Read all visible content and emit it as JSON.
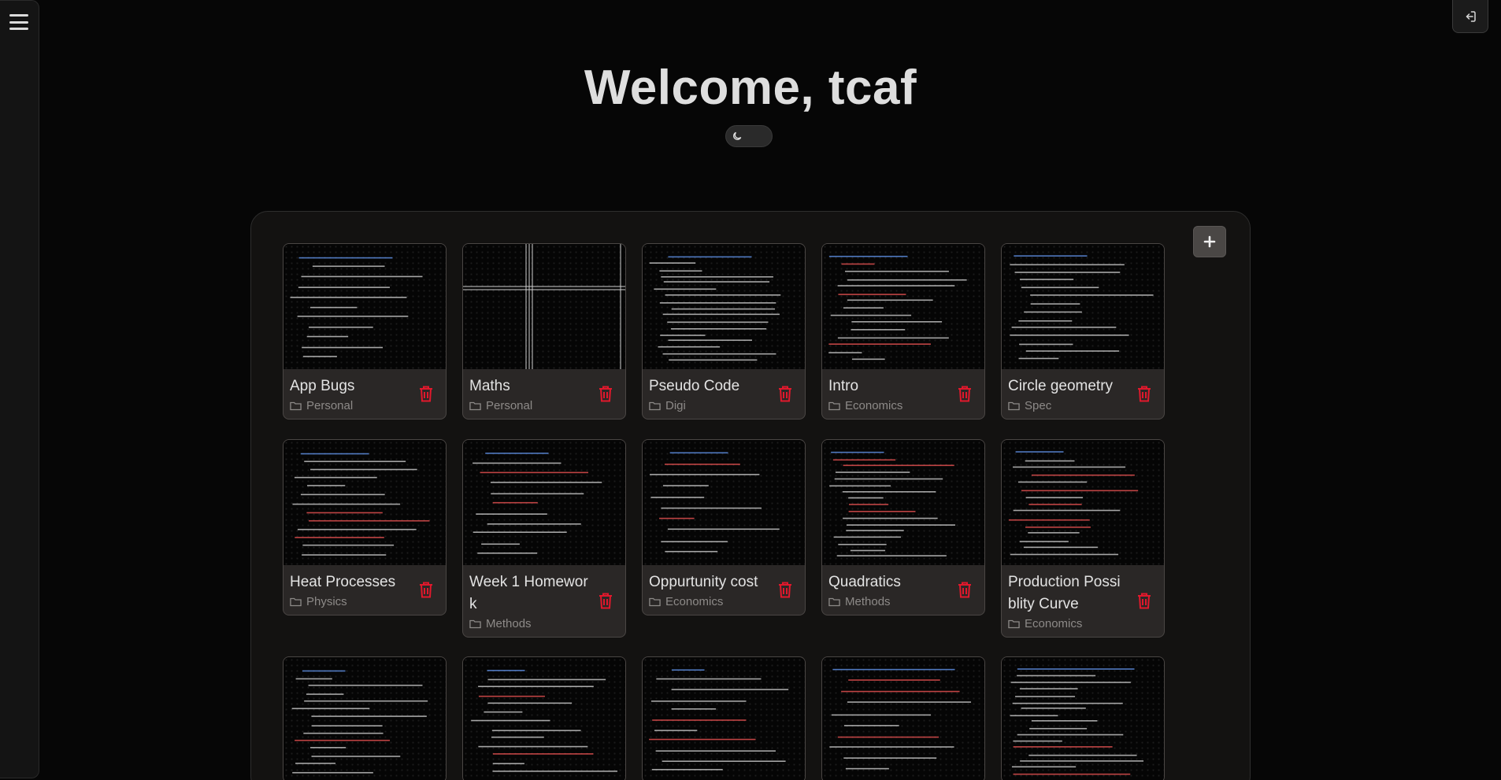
{
  "header": {
    "welcome": "Welcome, tcaf"
  },
  "colors": {
    "accent_danger": "#e1182c",
    "background": "#060606",
    "panel": "#131211",
    "card": "#2a2726"
  },
  "icons": {
    "menu": "hamburger-icon",
    "logout": "logout-icon",
    "theme": "moon-icon",
    "add": "plus-icon",
    "folder": "folder-icon",
    "delete": "trash-icon"
  },
  "notes": [
    {
      "title": "App Bugs",
      "folder": "Personal"
    },
    {
      "title": "Maths",
      "folder": "Personal"
    },
    {
      "title": "Pseudo Code",
      "folder": "Digi"
    },
    {
      "title": "Intro",
      "folder": "Economics"
    },
    {
      "title": "Circle geometry",
      "folder": "Spec"
    },
    {
      "title": "Heat Processes",
      "folder": "Physics"
    },
    {
      "title": "Week 1 Homework",
      "folder": "Methods"
    },
    {
      "title": "Oppurtunity cost",
      "folder": "Economics"
    },
    {
      "title": "Quadratics",
      "folder": "Methods"
    },
    {
      "title": "Production Possiblity Curve",
      "folder": "Economics"
    },
    {
      "title": "",
      "folder": ""
    },
    {
      "title": "",
      "folder": ""
    },
    {
      "title": "",
      "folder": ""
    },
    {
      "title": "",
      "folder": ""
    },
    {
      "title": "",
      "folder": ""
    }
  ]
}
